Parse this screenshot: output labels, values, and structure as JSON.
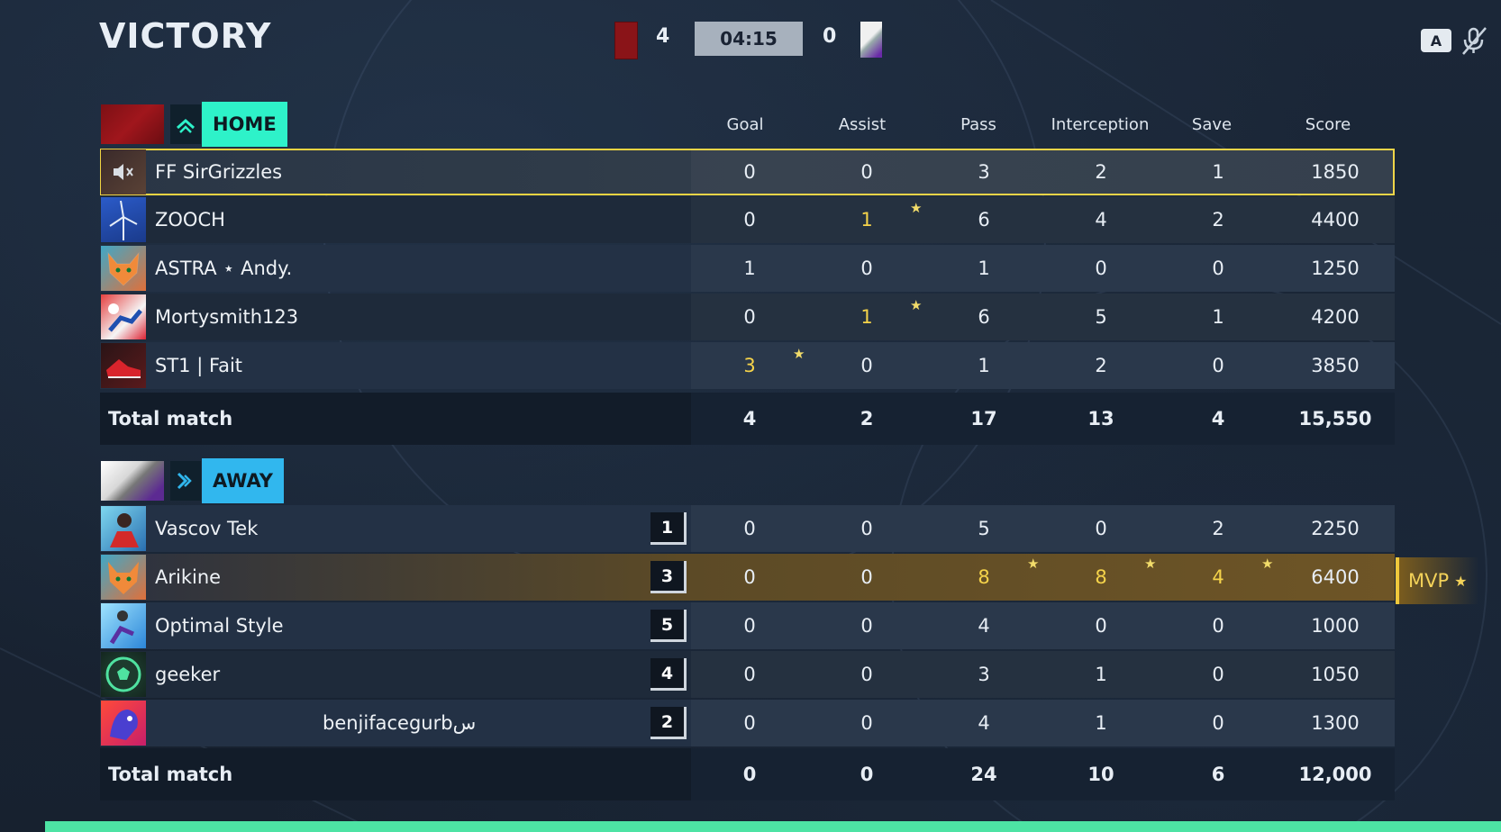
{
  "header": {
    "title": "VICTORY",
    "home_score": "4",
    "away_score": "0",
    "timer": "04:15",
    "key_hint": "A"
  },
  "columns": [
    "Goal",
    "Assist",
    "Pass",
    "Interception",
    "Save",
    "Score"
  ],
  "home": {
    "label": "HOME",
    "players": [
      {
        "name": "FF SirGrizzles",
        "stats": [
          "0",
          "0",
          "3",
          "2",
          "1",
          "1850"
        ]
      },
      {
        "name": "ZOOCH",
        "stats": [
          "0",
          "1",
          "6",
          "4",
          "2",
          "4400"
        ]
      },
      {
        "name": "ASTRA ⋆ Andy.",
        "stats": [
          "1",
          "0",
          "1",
          "0",
          "0",
          "1250"
        ]
      },
      {
        "name": "Mortysmith123",
        "stats": [
          "0",
          "1",
          "6",
          "5",
          "1",
          "4200"
        ]
      },
      {
        "name": "ST1 | Fait",
        "stats": [
          "3",
          "0",
          "1",
          "2",
          "0",
          "3850"
        ]
      }
    ],
    "total_label": "Total match",
    "totals": [
      "4",
      "2",
      "17",
      "13",
      "4",
      "15,550"
    ]
  },
  "away": {
    "label": "AWAY",
    "players": [
      {
        "name": "Vascov Tek",
        "rank": "1",
        "stats": [
          "0",
          "0",
          "5",
          "0",
          "2",
          "2250"
        ]
      },
      {
        "name": "Arikine",
        "rank": "3",
        "stats": [
          "0",
          "0",
          "8",
          "8",
          "4",
          "6400"
        ]
      },
      {
        "name": "Optimal Style",
        "rank": "5",
        "stats": [
          "0",
          "0",
          "4",
          "0",
          "0",
          "1000"
        ]
      },
      {
        "name": "geeker",
        "rank": "4",
        "stats": [
          "0",
          "0",
          "3",
          "1",
          "0",
          "1050"
        ]
      },
      {
        "name": "benjifacegurbس",
        "rank": "2",
        "stats": [
          "0",
          "0",
          "4",
          "1",
          "0",
          "1300"
        ]
      }
    ],
    "total_label": "Total match",
    "totals": [
      "0",
      "0",
      "24",
      "10",
      "6",
      "12,000"
    ]
  },
  "mvp": {
    "label": "MVP",
    "star": "★"
  },
  "colors": {
    "home_accent": "#2ef2c9",
    "away_accent": "#31b7ee",
    "highlight": "#f5d34a"
  }
}
